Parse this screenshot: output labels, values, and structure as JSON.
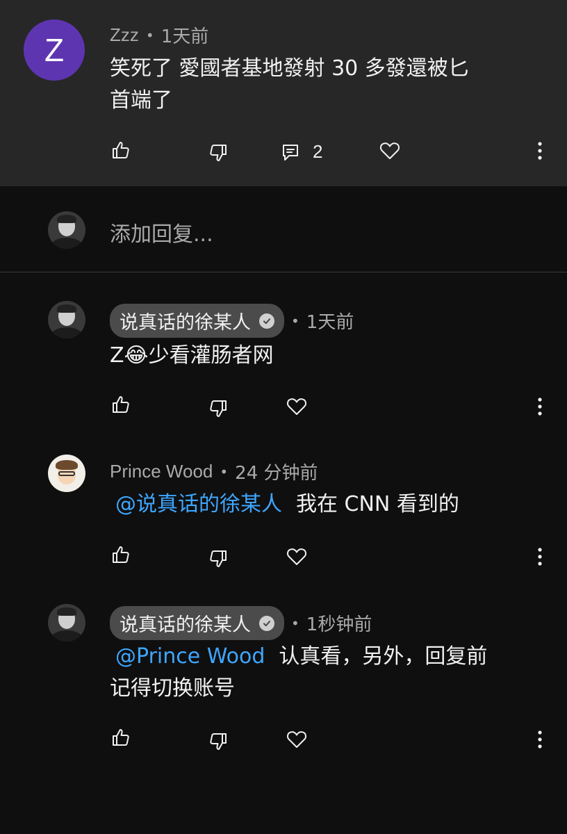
{
  "parent_comment": {
    "avatar_letter": "Z",
    "author": "Zzz",
    "time": "1天前",
    "text_line1": "笑死了 愛國者基地發射 30 多發還被匕",
    "text_line2": "首端了",
    "reply_count": "2"
  },
  "add_reply": {
    "placeholder": "添加回复..."
  },
  "replies": [
    {
      "author": "说真话的徐某人",
      "verified": true,
      "time": "1天前",
      "text": "Z😂少看灌肠者网"
    },
    {
      "author": "Prince Wood",
      "time": "24 分钟前",
      "mention": "@说真话的徐某人",
      "text": "我在 CNN 看到的"
    },
    {
      "author": "说真话的徐某人",
      "verified": true,
      "time": "1秒钟前",
      "mention": "@Prince Wood",
      "text_line1": "认真看，另外，回复前",
      "text_line2": "记得切换账号"
    }
  ],
  "separator": "•",
  "colors": {
    "page_bg": "#0f0f0f",
    "parent_bg": "#272727",
    "mention": "#3ea6ff",
    "avatar_letter_bg": "#5e35b1"
  }
}
